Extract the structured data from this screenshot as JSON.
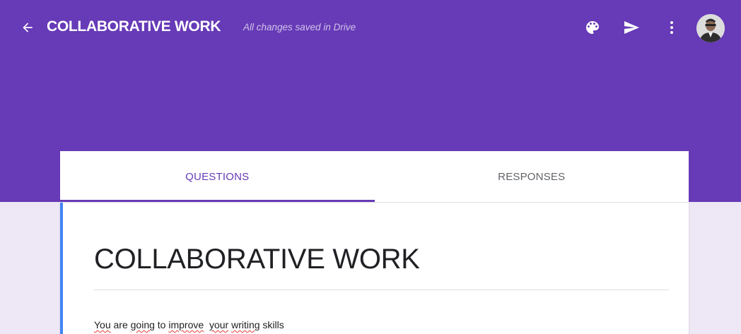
{
  "header": {
    "title": "COLLABORATIVE WORK",
    "saved_status": "All changes saved in Drive",
    "icons": [
      "back-arrow-icon",
      "palette-icon",
      "send-icon",
      "more-vert-icon"
    ],
    "avatar": "user-avatar"
  },
  "tabs": [
    {
      "label": "QUESTIONS",
      "active": true
    },
    {
      "label": "RESPONSES",
      "active": false
    }
  ],
  "form": {
    "title": "COLLABORATIVE WORK",
    "description_parts": [
      "You",
      " are ",
      "going",
      " to ",
      "improve",
      "  ",
      "your",
      " ",
      "writing",
      " skills"
    ]
  },
  "colors": {
    "theme": "#673ab7",
    "background": "#ede7f6",
    "accent_bar": "#4285f4"
  }
}
